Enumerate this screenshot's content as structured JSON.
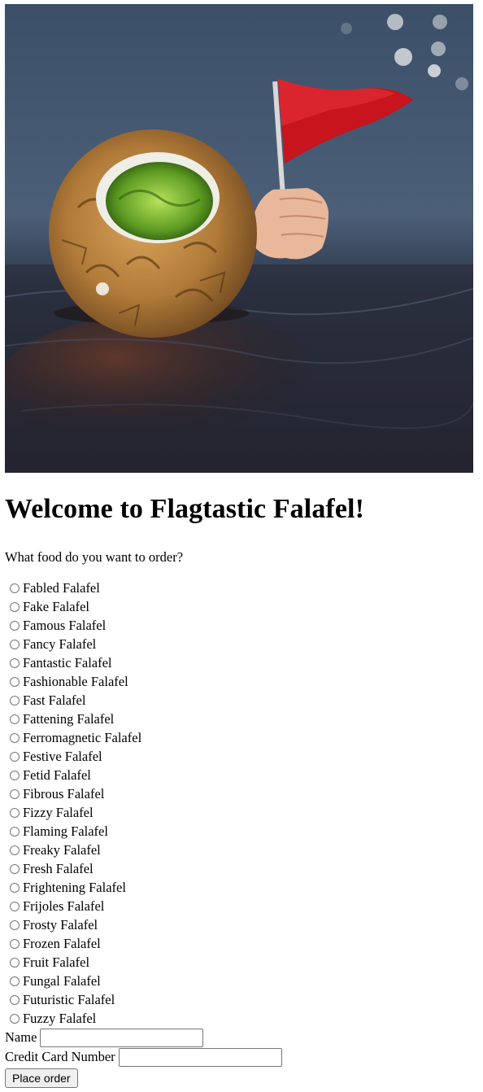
{
  "hero": {
    "image_icon": "falafel-with-red-flag-image"
  },
  "title": "Welcome to Flagtastic Falafel!",
  "prompt": "What food do you want to order?",
  "options": [
    "Fabled Falafel",
    "Fake Falafel",
    "Famous Falafel",
    "Fancy Falafel",
    "Fantastic Falafel",
    "Fashionable Falafel",
    "Fast Falafel",
    "Fattening Falafel",
    "Ferromagnetic Falafel",
    "Festive Falafel",
    "Fetid Falafel",
    "Fibrous Falafel",
    "Fizzy Falafel",
    "Flaming Falafel",
    "Freaky Falafel",
    "Fresh Falafel",
    "Frightening Falafel",
    "Frijoles Falafel",
    "Frosty Falafel",
    "Frozen Falafel",
    "Fruit Falafel",
    "Fungal Falafel",
    "Futuristic Falafel",
    "Fuzzy Falafel"
  ],
  "form": {
    "name_label": "Name",
    "name_value": "",
    "card_label": "Credit Card Number",
    "card_value": "",
    "submit_label": "Place order"
  }
}
